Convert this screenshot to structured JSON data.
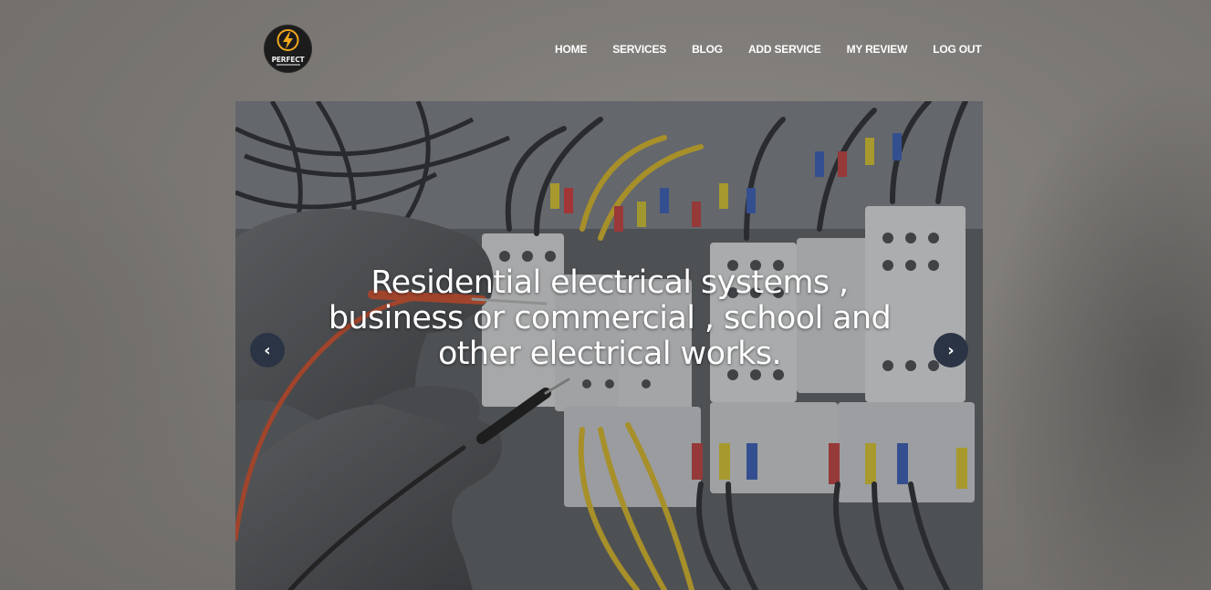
{
  "logo": {
    "text": "PERFECT",
    "icon": "lightning-bolt-icon",
    "colors": {
      "background": "#1c1c1c",
      "accent": "#f2a81d"
    }
  },
  "nav": {
    "items": [
      "HOME",
      "SERVICES",
      "BLOG",
      "ADD SERVICE",
      "MY REVIEW",
      "LOG OUT"
    ]
  },
  "hero": {
    "caption": "Residential electrical systems , business or commercial , school and other electrical works.",
    "prev_icon": "‹",
    "next_icon": "›"
  }
}
